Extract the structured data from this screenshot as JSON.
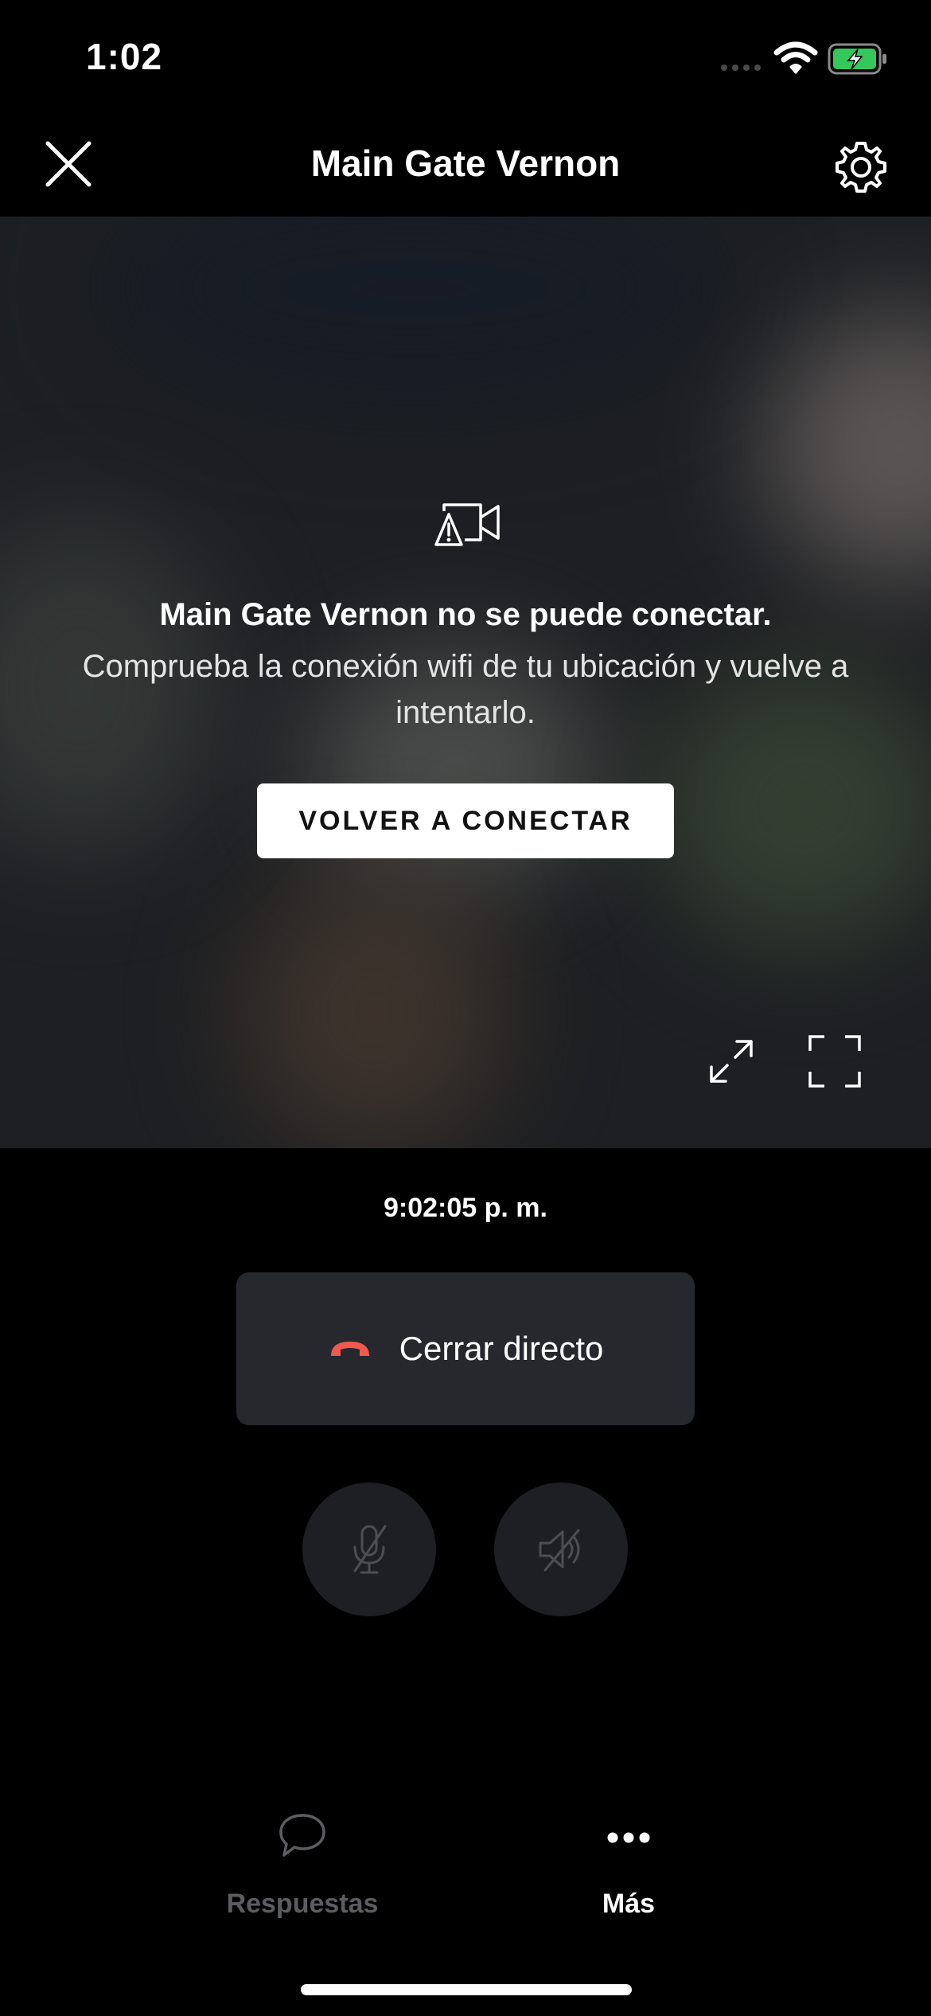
{
  "status_bar": {
    "time": "1:02"
  },
  "header": {
    "title": "Main Gate Vernon",
    "close_icon": "close-icon",
    "settings_icon": "gear-icon"
  },
  "video": {
    "error_title": "Main Gate Vernon no se puede conectar.",
    "error_message": "Comprueba la conexión wifi de tu ubicación y vuelve a intentarlo.",
    "reconnect_label": "VOLVER A CONECTAR",
    "icons": [
      "camera-warning-icon",
      "expand-arrows-icon",
      "fullscreen-icon"
    ]
  },
  "timestamp": "9:02:05 p. m.",
  "end_live": {
    "label": "Cerrar directo",
    "icon": "hang-up-icon",
    "icon_color": "#ee5a4f"
  },
  "controls": {
    "mic_icon": "microphone-muted-icon",
    "speaker_icon": "speaker-muted-icon"
  },
  "tabs": [
    {
      "label": "Respuestas",
      "icon": "chat-bubble-icon",
      "color": "#5c5d61"
    },
    {
      "label": "Más",
      "icon": "more-dots-icon",
      "color": "#ffffff"
    }
  ]
}
